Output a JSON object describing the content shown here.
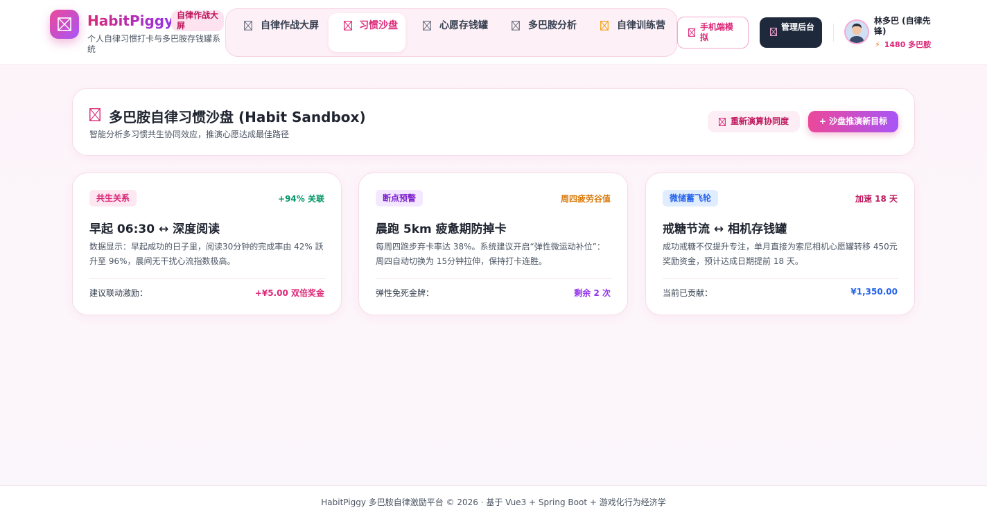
{
  "header": {
    "brand_name": "HabitPiggy",
    "brand_badge": "自律作战大屏",
    "brand_subtitle": "个人自律习惯打卡与多巴胺存钱罐系统",
    "nav": [
      {
        "label": "自律作战大屏",
        "active": false
      },
      {
        "label": "习惯沙盘",
        "active": true
      },
      {
        "label": "心愿存钱罐",
        "active": false
      },
      {
        "label": "多巴胺分析",
        "active": false
      },
      {
        "label": "自律训练营",
        "active": false
      }
    ],
    "mobile_button": "手机端模拟",
    "admin_button": "管理后台",
    "user": {
      "name": "林多巴 (自律先锋)",
      "points": "1480 多巴胺"
    }
  },
  "sandbox": {
    "title": "多巴胺自律习惯沙盘 (Habit Sandbox)",
    "subtitle": "智能分析多习惯共生协同效应，推演心愿达成最佳路径",
    "recalc_button": "重新演算协同度",
    "new_goal_button": "+ 沙盘推演新目标"
  },
  "cards": [
    {
      "tag": "共生关系",
      "metric": "+94% 关联",
      "title": "早起 06:30 ↔ 深度阅读",
      "desc": "数据显示：早起成功的日子里，阅读30分钟的完成率由 42% 跃升至 96%，晨间无干扰心流指数极高。",
      "footer_label": "建议联动激励：",
      "footer_value": "+¥5.00 双倍奖金"
    },
    {
      "tag": "断点预警",
      "metric": "周四疲劳谷值",
      "title": "晨跑 5km 疲惫期防掉卡",
      "desc": "每周四跑步弃卡率达 38%。系统建议开启“弹性微运动补位”：周四自动切换为 15分钟拉伸，保持打卡连胜。",
      "footer_label": "弹性免死金牌：",
      "footer_value": "剩余 2 次"
    },
    {
      "tag": "微储蓄飞轮",
      "metric": "加速 18 天",
      "title": "戒糖节流 ↔ 相机存钱罐",
      "desc": "成功戒糖不仅提升专注，单月直接为索尼相机心愿罐转移 450元奖励资金，预计达成日期提前 18 天。",
      "footer_label": "当前已贡献：",
      "footer_value": "¥1,350.00"
    }
  ],
  "footer": {
    "text": "HabitPiggy 多巴胺自律激励平台 © 2026 · 基于 Vue3 + Spring Boot + 游戏化行为经济学"
  },
  "colors": {
    "accent_pink": "#db2777",
    "accent_purple": "#9333ea",
    "nav_icon_warning": "#f59e0b",
    "success_green": "#059669",
    "warning_orange": "#d97706",
    "danger_rose": "#be185d",
    "info_blue": "#2563eb"
  }
}
